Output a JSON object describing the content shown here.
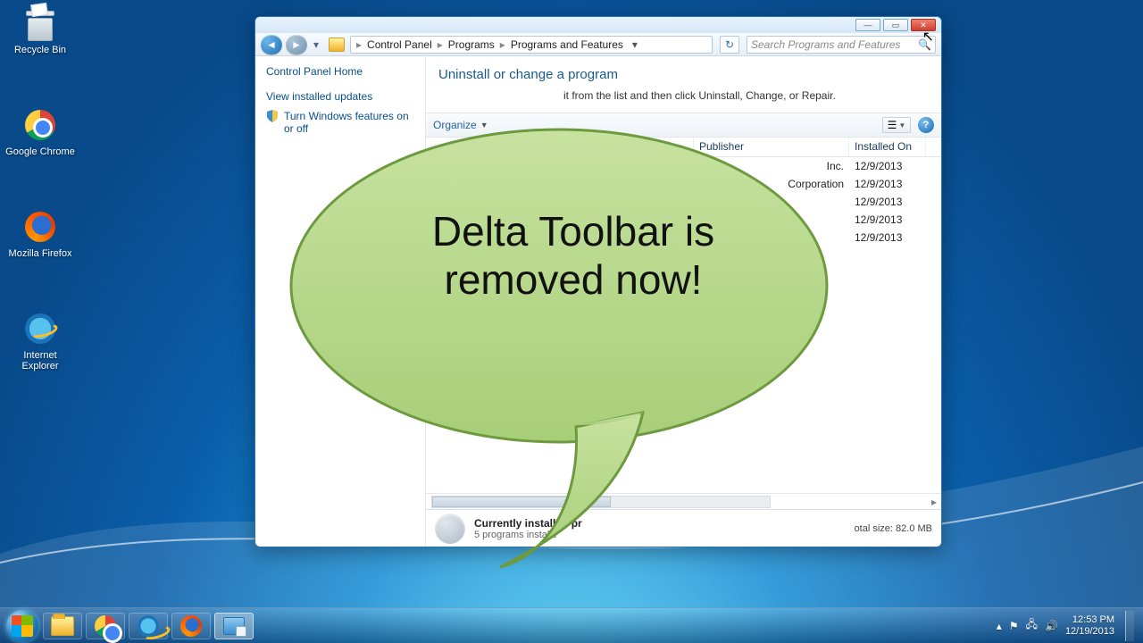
{
  "desktop": {
    "icons": [
      {
        "label": "Recycle Bin"
      },
      {
        "label": "Google Chrome"
      },
      {
        "label": "Mozilla Firefox"
      },
      {
        "label": "Internet Explorer"
      }
    ]
  },
  "window": {
    "breadcrumb": [
      "Control Panel",
      "Programs",
      "Programs and Features"
    ],
    "search_placeholder": "Search Programs and Features",
    "left": {
      "home": "Control Panel Home",
      "link_updates": "View installed updates",
      "link_features": "Turn Windows features on or off"
    },
    "main": {
      "heading": "Uninstall or change a program",
      "subtext": "it from the list and then click Uninstall, Change, or Repair.",
      "organize": "Organize",
      "columns": {
        "publisher": "Publisher",
        "installed": "Installed On"
      },
      "rows": [
        {
          "publisher": "Inc.",
          "date": "12/9/2013"
        },
        {
          "publisher": "Corporation",
          "date": "12/9/2013"
        },
        {
          "publisher": "",
          "date": "12/9/2013"
        },
        {
          "publisher": "",
          "date": "12/9/2013"
        },
        {
          "publisher": "",
          "date": "12/9/2013"
        }
      ],
      "status_title": "Currently installed pr",
      "status_sub": "5 programs installe",
      "status_size": "otal size: 82.0 MB"
    }
  },
  "bubble": {
    "line1": "Delta Toolbar is",
    "line2": "removed now!"
  },
  "taskbar": {
    "time": "12:53 PM",
    "date": "12/19/2013"
  }
}
